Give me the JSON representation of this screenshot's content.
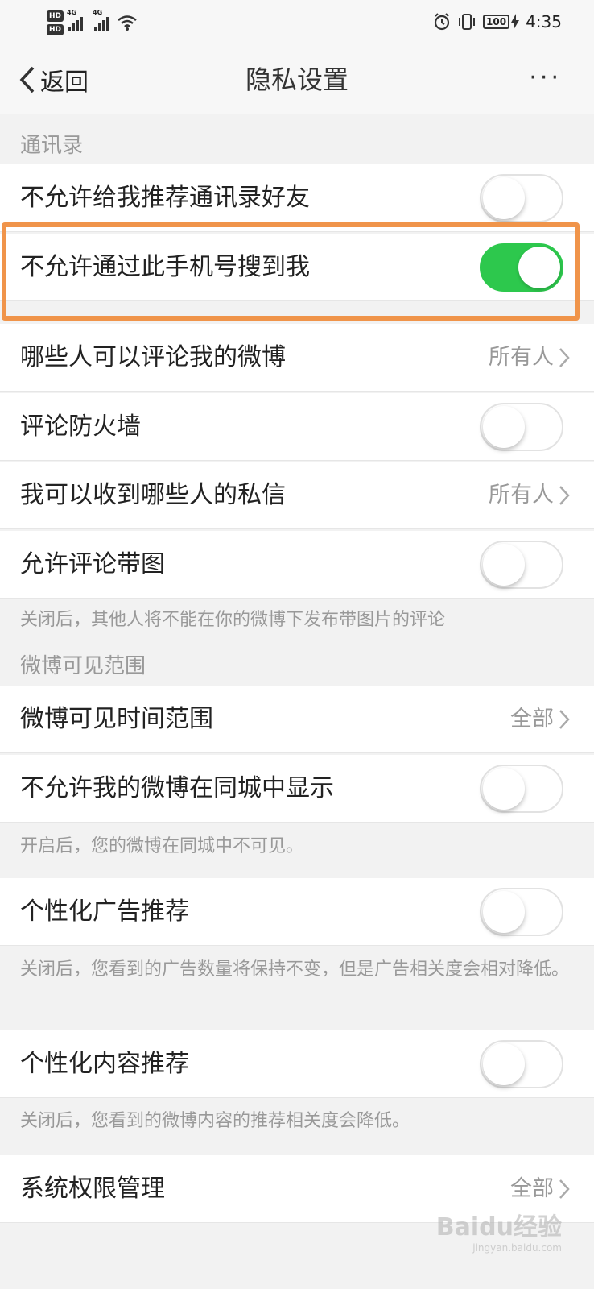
{
  "status_bar": {
    "hd1": "HD",
    "hd2": "HD",
    "net1": "4G",
    "net2": "4G",
    "wifi_icon": "wifi-icon",
    "alarm_icon": "alarm-icon",
    "vibrate_icon": "vibrate-icon",
    "battery": "100",
    "charging_icon": "charging-icon",
    "time": "4:35"
  },
  "header": {
    "back_label": "返回",
    "title": "隐私设置",
    "more_label": "···"
  },
  "sections": {
    "contacts": "通讯录",
    "weibo_visibility": "微博可见范围"
  },
  "rows": {
    "no_recommend_contacts": {
      "label": "不允许给我推荐通讯录好友",
      "on": false
    },
    "no_search_by_phone": {
      "label": "不允许通过此手机号搜到我",
      "on": true
    },
    "who_can_comment": {
      "label": "哪些人可以评论我的微博",
      "value": "所有人"
    },
    "comment_firewall": {
      "label": "评论防火墙",
      "on": false
    },
    "who_can_message": {
      "label": "我可以收到哪些人的私信",
      "value": "所有人"
    },
    "allow_image_comments": {
      "label": "允许评论带图",
      "on": false
    },
    "visible_time_range": {
      "label": "微博可见时间范围",
      "value": "全部"
    },
    "hide_in_local": {
      "label": "不允许我的微博在同城中显示",
      "on": false
    },
    "personalized_ads": {
      "label": "个性化广告推荐",
      "on": false
    },
    "personalized_content": {
      "label": "个性化内容推荐",
      "on": false
    },
    "system_permissions": {
      "label": "系统权限管理",
      "value": "全部"
    }
  },
  "notes": {
    "image_comments": "关闭后，其他人将不能在你的微博下发布带图片的评论",
    "local": "开启后，您的微博在同城中不可见。",
    "ads": "关闭后，您看到的广告数量将保持不变，但是广告相关度会相对降低。",
    "content": "关闭后，您看到的微博内容的推荐相关度会降低。"
  },
  "watermark": {
    "brand": "Baidu经验",
    "url": "jingyan.baidu.com"
  },
  "colors": {
    "toggle_on": "#2dc84d",
    "highlight": "#f0944a"
  }
}
